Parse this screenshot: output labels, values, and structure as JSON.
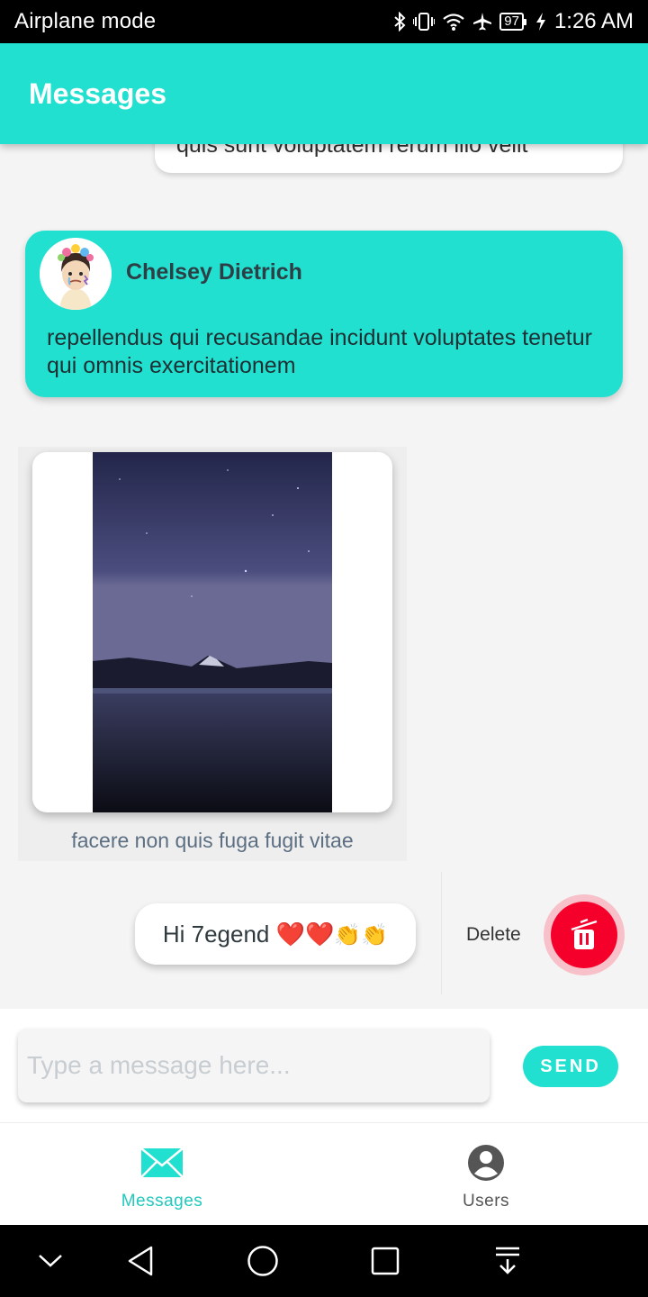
{
  "status_bar": {
    "mode": "Airplane mode",
    "battery": "97",
    "time": "1:26 AM"
  },
  "header": {
    "title": "Messages"
  },
  "messages": {
    "partial_text": "quis sunt voluptatem rerum illo velit",
    "received": {
      "sender": "Chelsey Dietrich",
      "text": "repellendus qui recusandae incidunt voluptates tenetur qui omnis exercitationem"
    },
    "image_message": {
      "caption": "facere non quis fuga fugit vitae"
    },
    "sent": {
      "text": "Hi 7egend",
      "emoji": [
        "❤️",
        "❤️",
        "👏",
        "👏"
      ]
    },
    "swipe_action": {
      "label": "Delete"
    }
  },
  "composer": {
    "placeholder": "Type a message here...",
    "send_label": "SEND"
  },
  "bottom_nav": {
    "items": [
      {
        "label": "Messages",
        "icon": "envelope-icon",
        "active": true
      },
      {
        "label": "Users",
        "icon": "user-circle-icon",
        "active": false
      }
    ]
  },
  "colors": {
    "accent": "#22e0d0",
    "delete": "#f4002a"
  }
}
